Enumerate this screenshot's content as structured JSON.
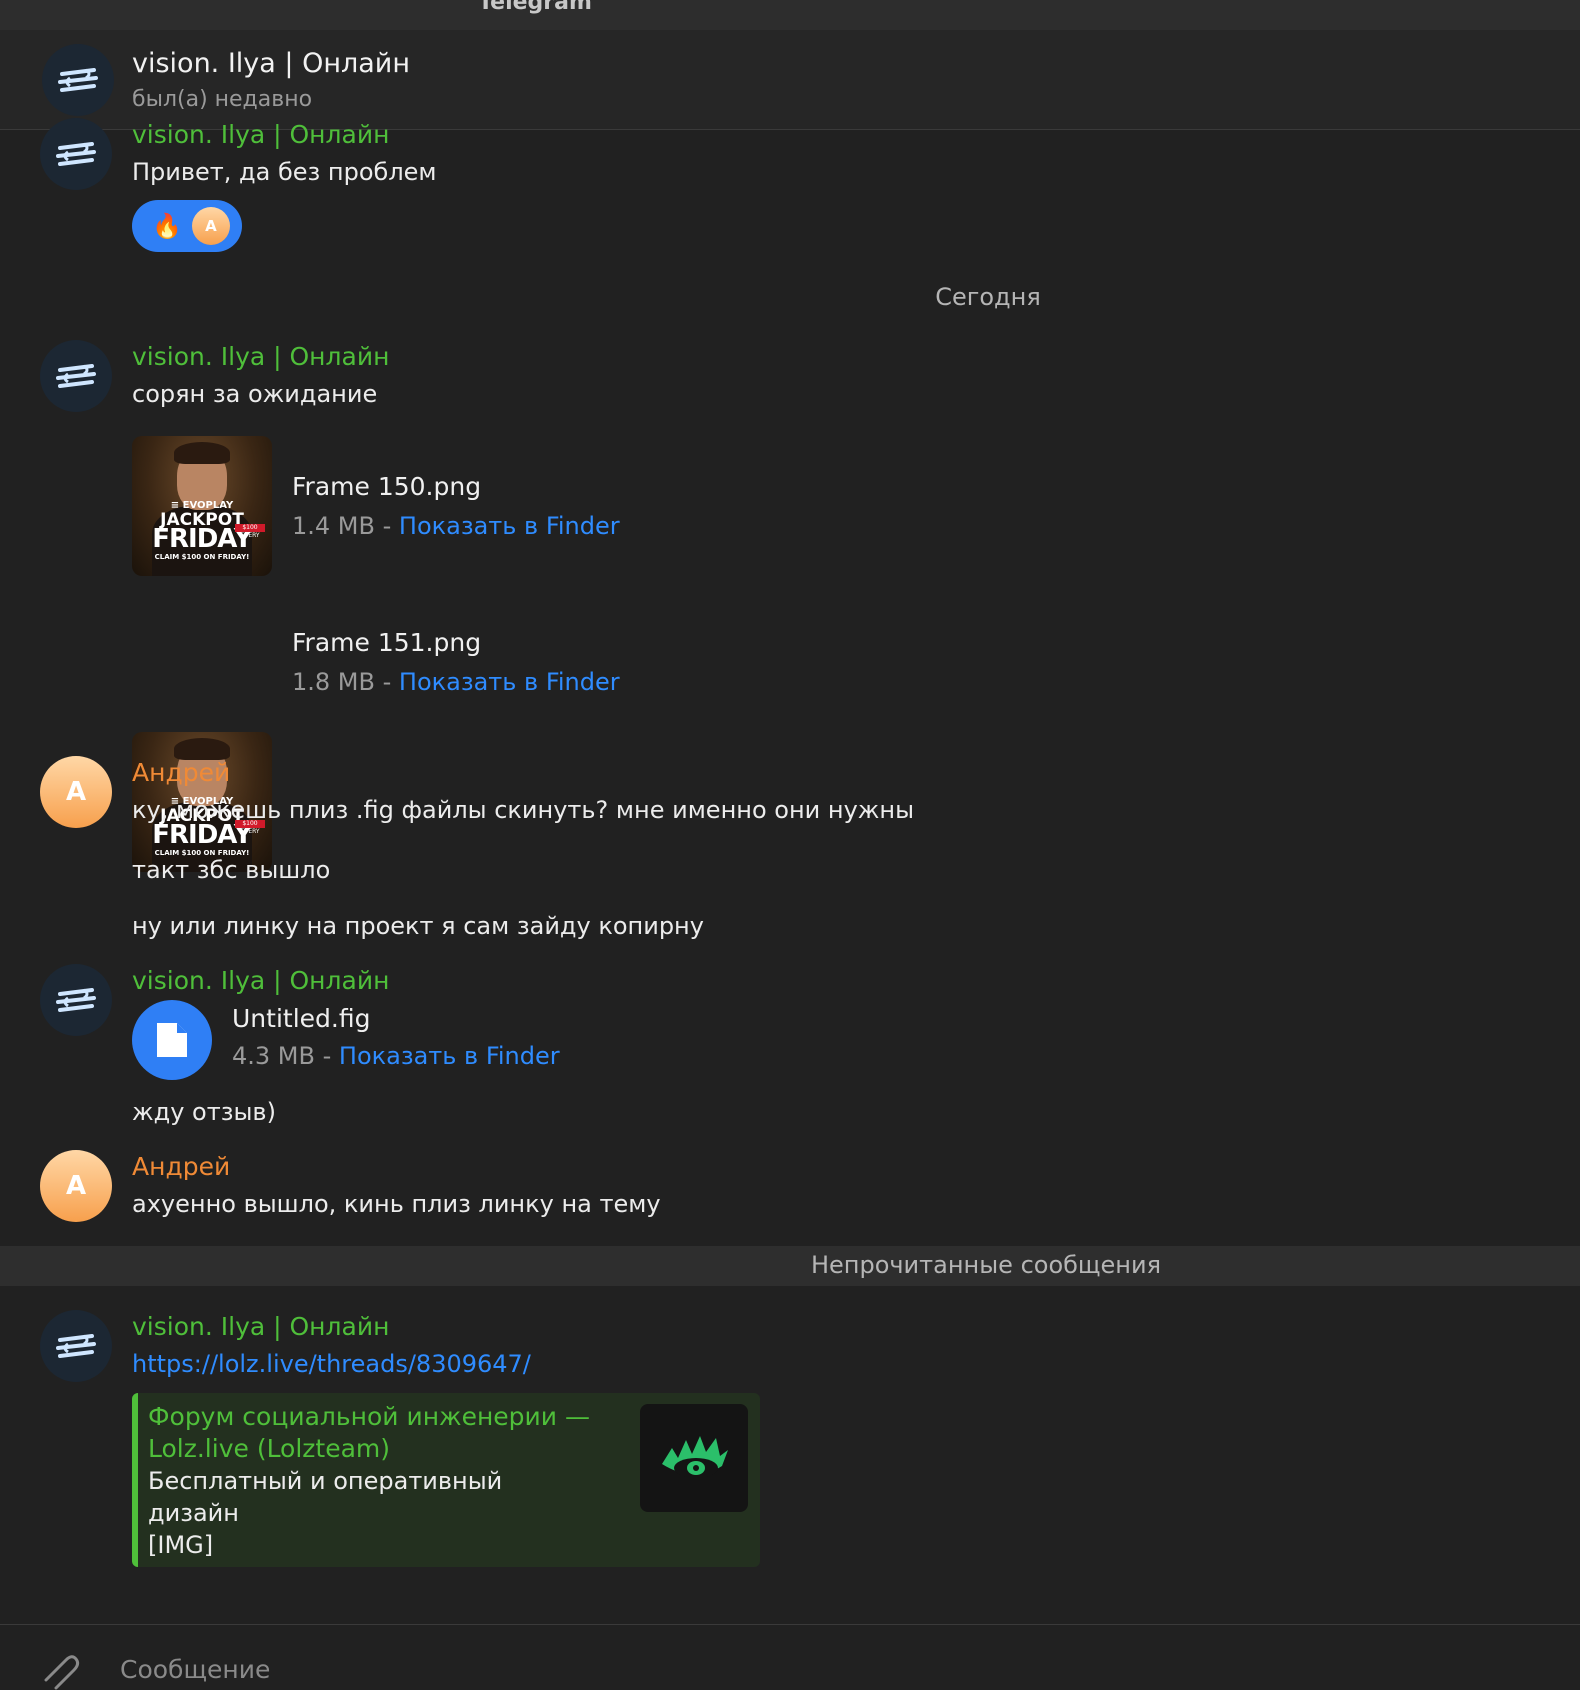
{
  "window": {
    "title": "Telegram"
  },
  "header": {
    "name": "vision. Ilya | Онлайн",
    "status": "был(а) недавно"
  },
  "messages": {
    "m1": {
      "sender": "vision. Ilya | Онлайн",
      "text": "Привет, да без проблем",
      "reaction": {
        "emoji": "🔥",
        "avatar_letter": "А"
      }
    },
    "date_separator": "Сегодня",
    "m2": {
      "sender": "vision. Ilya | Онлайн",
      "text": "сорян за ожидание",
      "files": [
        {
          "name": "Frame 150.png",
          "size": "1.4 MB - ",
          "action": "Показать в Finder"
        },
        {
          "name": "Frame 151.png",
          "size": "1.8 MB - ",
          "action": "Показать в Finder"
        }
      ],
      "thumb_text": {
        "brand": "≡ EVOPLAY",
        "line1": "JACKPOT",
        "line2": "FRIDAY",
        "line3": "CLAIM $100 ON FRIDAY!",
        "badge": "$100 EVERY"
      }
    },
    "m3": {
      "sender": "Андрей",
      "avatar_letter": "А",
      "texts": [
        "ку, можешь плиз .fig файлы скинуть? мне именно они нужны",
        "такт збс вышло",
        "ну или линку на проект я сам зайду копирну"
      ]
    },
    "m4": {
      "sender": "vision. Ilya | Онлайн",
      "file": {
        "name": "Untitled.fig",
        "size": "4.3 MB - ",
        "action": "Показать в Finder"
      },
      "text": "жду отзыв)"
    },
    "m5": {
      "sender": "Андрей",
      "avatar_letter": "А",
      "text": "ахуенно вышло, кинь плиз линку на тему"
    },
    "unread_separator": "Непрочитанные сообщения",
    "m6": {
      "sender": "vision. Ilya | Онлайн",
      "link": "https://lolz.live/threads/8309647/",
      "preview": {
        "title": "Форум социальной инженерии — Lolz.live (Lolzteam)",
        "desc_line1": "Бесплатный и оперативный",
        "desc_line2": "дизайн",
        "desc_line3": "[IMG]"
      }
    }
  },
  "composer": {
    "placeholder": "Сообщение"
  },
  "colors": {
    "accent_green": "#4fbf3a",
    "accent_orange": "#f08a36",
    "link_blue": "#2f8cff",
    "background": "#212121"
  }
}
